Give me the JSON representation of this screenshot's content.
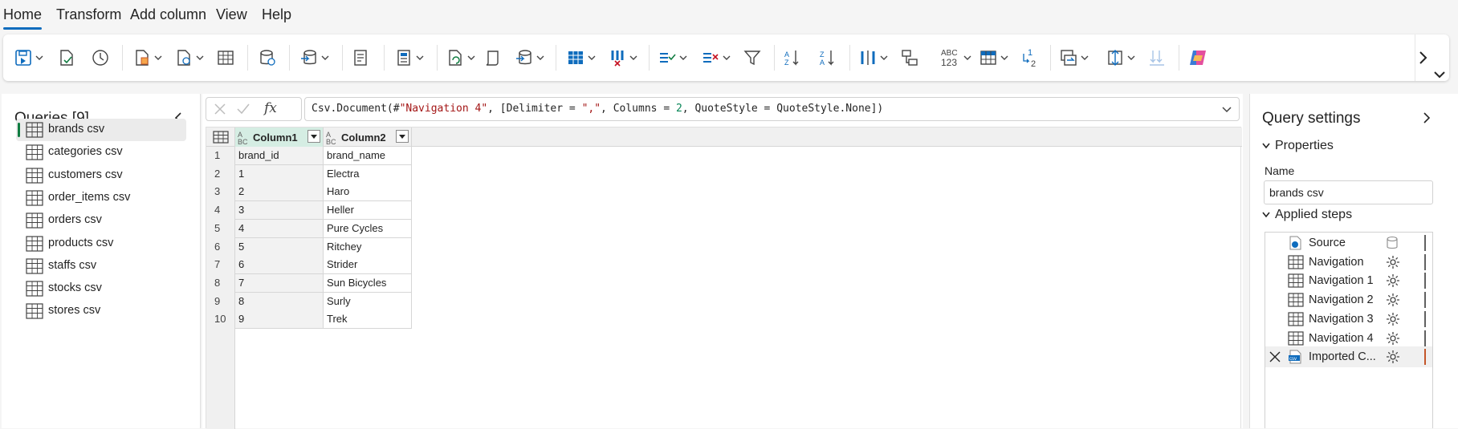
{
  "menu": {
    "tabs": [
      "Home",
      "Transform",
      "Add column",
      "View",
      "Help"
    ],
    "active_tab": "Home"
  },
  "ribbon": {
    "buttons": [
      "save-icon",
      "export-template-icon",
      "refresh-history-icon",
      "get-data-icon",
      "recent-sources-icon",
      "enter-data-icon",
      "options-icon",
      "manage-connections-icon",
      "refresh-icon",
      "properties-icon",
      "advanced-editor-icon",
      "manage-icon",
      "choose-columns-icon",
      "remove-columns-icon",
      "keep-rows-icon",
      "remove-rows-icon",
      "filter-icon",
      "sort-ascending-icon",
      "sort-descending-icon",
      "split-column-icon",
      "group-by-icon",
      "data-type-icon",
      "use-first-row-as-headers-icon",
      "replace-values-icon",
      "combine-icon",
      "map-to-entity-icon",
      "add-data-destination-icon",
      "copilot-icon"
    ],
    "data_type_text_top": "ABC",
    "data_type_text_bottom": "123",
    "replace_values_text": "1 2"
  },
  "queries": {
    "title": "Queries [9]",
    "items": [
      {
        "label": "brands csv",
        "selected": true
      },
      {
        "label": "categories csv"
      },
      {
        "label": "customers csv"
      },
      {
        "label": "order_items csv"
      },
      {
        "label": "orders csv"
      },
      {
        "label": "products csv"
      },
      {
        "label": "staffs csv"
      },
      {
        "label": "stocks csv"
      },
      {
        "label": "stores csv"
      }
    ]
  },
  "formula": {
    "fx_label": "fx",
    "segments": [
      {
        "text": "Csv.Document(#",
        "cls": ""
      },
      {
        "text": "\"Navigation 4\"",
        "cls": "str"
      },
      {
        "text": ", [Delimiter = ",
        "cls": ""
      },
      {
        "text": "\",\"",
        "cls": "str"
      },
      {
        "text": ", Columns = ",
        "cls": ""
      },
      {
        "text": "2",
        "cls": "num"
      },
      {
        "text": ", QuoteStyle = QuoteStyle.None])",
        "cls": ""
      }
    ]
  },
  "grid": {
    "columns": [
      {
        "type_label": "ABC",
        "name": "Column1"
      },
      {
        "type_label": "ABC",
        "name": "Column2"
      }
    ],
    "rows": [
      [
        "brand_id",
        "brand_name"
      ],
      [
        "1",
        "Electra"
      ],
      [
        "2",
        "Haro"
      ],
      [
        "3",
        "Heller"
      ],
      [
        "4",
        "Pure Cycles"
      ],
      [
        "5",
        "Ritchey"
      ],
      [
        "6",
        "Strider"
      ],
      [
        "7",
        "Sun Bicycles"
      ],
      [
        "8",
        "Surly"
      ],
      [
        "9",
        "Trek"
      ]
    ],
    "row_numbers": [
      "1",
      "2",
      "3",
      "4",
      "5",
      "6",
      "7",
      "8",
      "9",
      "10"
    ]
  },
  "settings": {
    "title": "Query settings",
    "properties_label": "Properties",
    "name_label": "Name",
    "name_value": "brands csv",
    "applied_steps_label": "Applied steps",
    "steps": [
      {
        "label": "Source",
        "icon": "source-icon"
      },
      {
        "label": "Navigation",
        "icon": "table-icon"
      },
      {
        "label": "Navigation 1",
        "icon": "table-icon"
      },
      {
        "label": "Navigation 2",
        "icon": "table-icon"
      },
      {
        "label": "Navigation 3",
        "icon": "table-icon"
      },
      {
        "label": "Navigation 4",
        "icon": "table-icon"
      },
      {
        "label": "Imported C...",
        "icon": "csv-icon",
        "selected": true
      }
    ]
  },
  "colors": {
    "accent": "#0f6cbd",
    "selected_indicator": "#107c41",
    "column_header_selected": "#d5ede3",
    "step_error_bar": "#c4562a"
  }
}
